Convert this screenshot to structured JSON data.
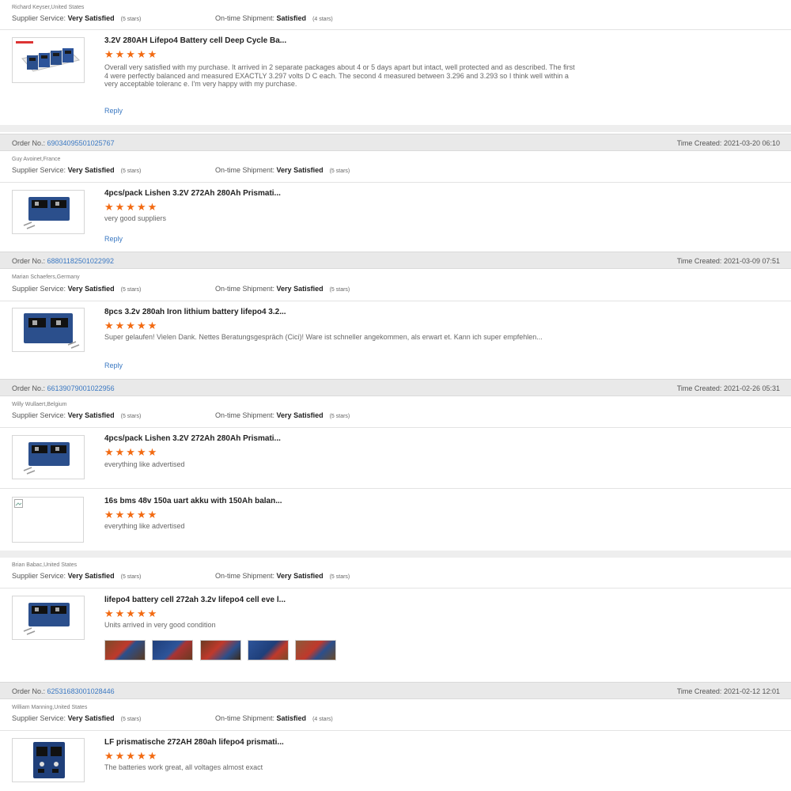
{
  "order_label": "Order No.:",
  "time_label": "Time Created:",
  "supplier_label": "Supplier Service:",
  "shipment_label": "On-time Shipment:",
  "reply_label": "Reply",
  "rating_stars": "★★★★★",
  "colors": {
    "accent_link": "#3a78c2",
    "star": "#f26a12",
    "order_bar": "#e9e9e9"
  },
  "reviews": [
    {
      "buyer": "Richard Keyser,United States",
      "supplier_value": "Very Satisfied",
      "supplier_stars": "(5 stars)",
      "shipment_value": "Satisfied",
      "shipment_stars": "(4 stars)",
      "items": [
        {
          "title": "3.2V 280AH Lifepo4 Battery cell Deep Cycle Ba...",
          "text": "Overall very satisfied with my purchase. It arrived in 2 separate packages about 4 or 5 days apart but intact, well protected and as described. The  first 4 were perfectly balanced and measured EXACTLY 3.297 volts D C each. The second 4 measured between 3.296 and 3.293 so I think well within a very acceptable toleranc e. I'm very happy with my purchase.",
          "thumb_icon": "battery-pack-thumbnail"
        }
      ]
    },
    {
      "order_no": "69034095501025767",
      "time_created": "2021-03-20 06:10",
      "buyer": "Guy Avoinet,France",
      "supplier_value": "Very Satisfied",
      "supplier_stars": "(5 stars)",
      "shipment_value": "Very Satisfied",
      "shipment_stars": "(5 stars)",
      "items": [
        {
          "title": "4pcs/pack Lishen 3.2V 272Ah 280Ah Prismati...",
          "text": "very good suppliers",
          "thumb_icon": "battery-cell-thumbnail"
        }
      ]
    },
    {
      "order_no": "68801182501022992",
      "time_created": "2021-03-09 07:51",
      "buyer": "Marian Schaefers,Germany",
      "supplier_value": "Very Satisfied",
      "supplier_stars": "(5 stars)",
      "shipment_value": "Very Satisfied",
      "shipment_stars": "(5 stars)",
      "items": [
        {
          "title": "8pcs 3.2v 280ah Iron lithium battery lifepo4 3.2...",
          "text": "Super gelaufen! Vielen Dank. Nettes Beratungsgespräch (Cici)! Ware ist schneller angekommen, als erwart et. Kann ich super empfehlen...",
          "thumb_icon": "battery-cell-thumbnail"
        }
      ]
    },
    {
      "order_no": "66139079001022956",
      "time_created": "2021-02-26 05:31",
      "buyer": "Willy Wullaert,Belgium",
      "supplier_value": "Very Satisfied",
      "supplier_stars": "(5 stars)",
      "shipment_value": "Very Satisfied",
      "shipment_stars": "(5 stars)",
      "items": [
        {
          "title": "4pcs/pack Lishen 3.2V 272Ah 280Ah Prismati...",
          "text": "everything like advertised",
          "thumb_icon": "battery-cell-thumbnail"
        },
        {
          "title": "16s bms 48v 150a uart akku with 150Ah balan...",
          "text": "everything like advertised",
          "thumb_icon": "broken-image-icon"
        }
      ]
    },
    {
      "buyer": "Brian Babac,United States",
      "supplier_value": "Very Satisfied",
      "supplier_stars": "(5 stars)",
      "shipment_value": "Very Satisfied",
      "shipment_stars": "(5 stars)",
      "items": [
        {
          "title": "lifepo4 battery cell 272ah 3.2v lifepo4 cell eve l...",
          "text": "Units arrived in very good condition",
          "thumb_icon": "battery-cell-thumbnail"
        }
      ]
    },
    {
      "order_no": "62531683001028446",
      "time_created": "2021-02-12 12:01",
      "buyer": "William Manning,United States",
      "supplier_value": "Very Satisfied",
      "supplier_stars": "(5 stars)",
      "shipment_value": "Satisfied",
      "shipment_stars": "(4 stars)",
      "items": [
        {
          "title": "LF prismatische 272AH 280ah lifepo4 prismati...",
          "text": "The batteries work great, all voltages almost exact",
          "thumb_icon": "battery-cell-thumbnail"
        }
      ]
    }
  ]
}
